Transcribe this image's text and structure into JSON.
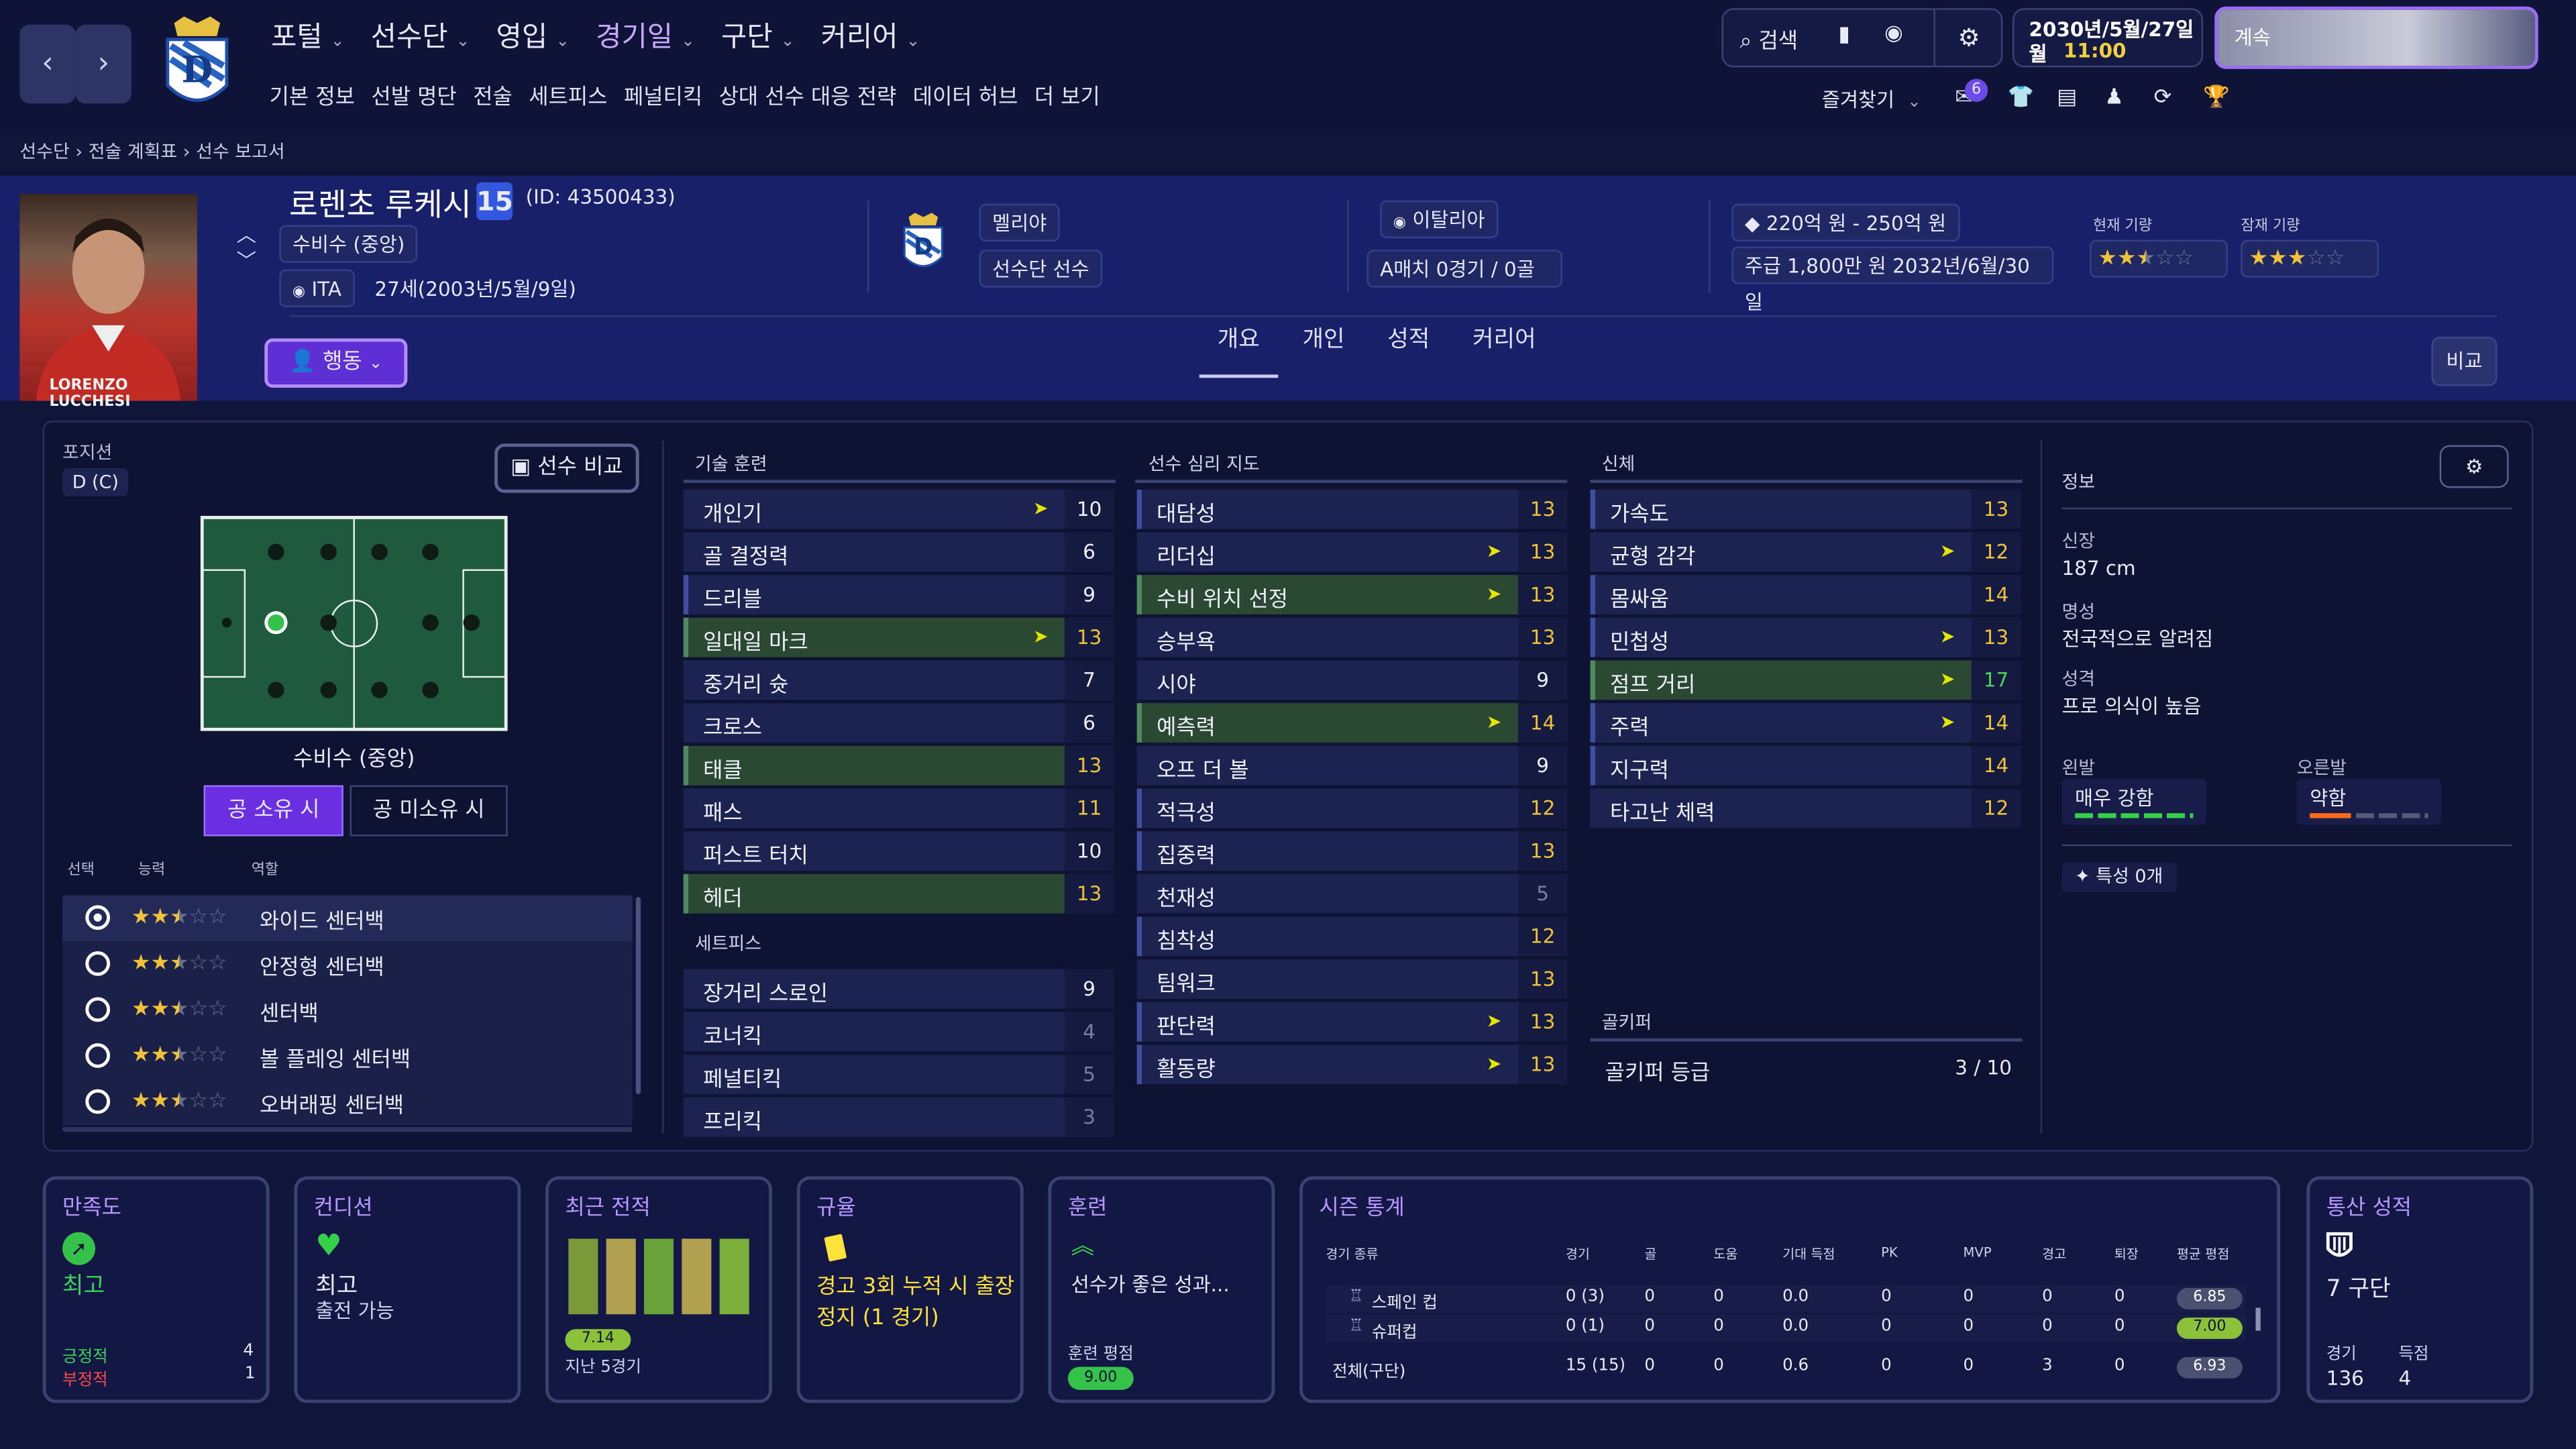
{
  "nav": {
    "menu": [
      "포털",
      "선수단",
      "영입",
      "경기일",
      "구단",
      "커리어"
    ],
    "active": "경기일",
    "submenu": [
      "기본 정보",
      "선발 명단",
      "전술",
      "세트피스",
      "페널티킥",
      "상대 선수 대응 전략",
      "데이터 허브",
      "더 보기"
    ],
    "search": "검색",
    "date_line1": "2030년/5월/27일",
    "date_line2": "월",
    "time": "11:00",
    "continue": "계속",
    "favorites": "즐겨찾기",
    "badge": "6"
  },
  "breadcrumb": [
    "선수단",
    "전술 계획표",
    "선수 보고서"
  ],
  "player": {
    "name": "로렌초 루케시",
    "number": "15",
    "id": "(ID: 43500433)",
    "position": "수비수 (중앙)",
    "nation": "ITA",
    "age": "27세(2003년/5월/9일)",
    "photo_caption": "LORENZO LUCCHESI",
    "club": "멜리야",
    "status": "선수단 선수",
    "nationality": "이탈리아",
    "caps": "A매치 0경기 / 0골",
    "value": "220억 원 - 250억 원",
    "wage": "주급 1,800만 원 2032년/6월/30일",
    "ca_label": "현재 기량",
    "pa_label": "잠재 기량",
    "ca_stars": 2.5,
    "pa_stars": 3,
    "action": "행동"
  },
  "tabs": [
    "개요",
    "개인",
    "성적",
    "커리어"
  ],
  "tabs_active": "개요",
  "compare": "비교",
  "left": {
    "pos_label": "포지션",
    "pos_value": "D (C)",
    "compare_btn": "선수 비교",
    "pitch_label": "수비수 (중앙)",
    "in_poss": "공 소유 시",
    "out_poss": "공 미소유 시",
    "col_select": "선택",
    "col_ability": "능력",
    "col_role": "역할",
    "roles": [
      {
        "name": "와이드 센터백",
        "stars": 2.5,
        "selected": true
      },
      {
        "name": "안정형 센터백",
        "stars": 2.5,
        "selected": false
      },
      {
        "name": "센터백",
        "stars": 2.5,
        "selected": false
      },
      {
        "name": "볼 플레잉 센터백",
        "stars": 2.5,
        "selected": false
      },
      {
        "name": "오버래핑 센터백",
        "stars": 2.5,
        "selected": false
      }
    ]
  },
  "technical": {
    "title": "기술 훈련",
    "attrs": [
      {
        "n": "개인기",
        "v": "10",
        "arrow": true
      },
      {
        "n": "골 결정력",
        "v": "6"
      },
      {
        "n": "드리블",
        "v": "9",
        "mark": "bl"
      },
      {
        "n": "일대일 마크",
        "v": "13",
        "mark": "hl",
        "arrow": true
      },
      {
        "n": "중거리 슛",
        "v": "7"
      },
      {
        "n": "크로스",
        "v": "6"
      },
      {
        "n": "태클",
        "v": "13",
        "mark": "hl"
      },
      {
        "n": "패스",
        "v": "11"
      },
      {
        "n": "퍼스트 터치",
        "v": "10"
      },
      {
        "n": "헤더",
        "v": "13",
        "mark": "hl"
      }
    ]
  },
  "setpieces": {
    "title": "세트피스",
    "attrs": [
      {
        "n": "장거리 스로인",
        "v": "9"
      },
      {
        "n": "코너킥",
        "v": "4"
      },
      {
        "n": "페널티킥",
        "v": "5"
      },
      {
        "n": "프리킥",
        "v": "3"
      }
    ]
  },
  "mental": {
    "title": "선수 심리 지도",
    "attrs": [
      {
        "n": "대담성",
        "v": "13",
        "mark": "bl"
      },
      {
        "n": "리더십",
        "v": "13",
        "arrow": true
      },
      {
        "n": "수비 위치 선정",
        "v": "13",
        "mark": "hl",
        "arrow": true
      },
      {
        "n": "승부욕",
        "v": "13"
      },
      {
        "n": "시야",
        "v": "9"
      },
      {
        "n": "예측력",
        "v": "14",
        "mark": "hl",
        "arrow": true
      },
      {
        "n": "오프 더 볼",
        "v": "9"
      },
      {
        "n": "적극성",
        "v": "12",
        "mark": "bl"
      },
      {
        "n": "집중력",
        "v": "13",
        "mark": "bl"
      },
      {
        "n": "천재성",
        "v": "5"
      },
      {
        "n": "침착성",
        "v": "12",
        "mark": "bl"
      },
      {
        "n": "팀워크",
        "v": "13"
      },
      {
        "n": "판단력",
        "v": "13",
        "mark": "bl",
        "arrow": true
      },
      {
        "n": "활동량",
        "v": "13",
        "mark": "bl",
        "arrow": true
      }
    ]
  },
  "physical": {
    "title": "신체",
    "attrs": [
      {
        "n": "가속도",
        "v": "13",
        "mark": "bl"
      },
      {
        "n": "균형 감각",
        "v": "12",
        "arrow": true
      },
      {
        "n": "몸싸움",
        "v": "14",
        "mark": "bl"
      },
      {
        "n": "민첩성",
        "v": "13",
        "mark": "bl",
        "arrow": true
      },
      {
        "n": "점프 거리",
        "v": "17",
        "mark": "hl",
        "arrow": true
      },
      {
        "n": "주력",
        "v": "14",
        "mark": "bl",
        "arrow": true
      },
      {
        "n": "지구력",
        "v": "14",
        "mark": "bl"
      },
      {
        "n": "타고난 체력",
        "v": "12"
      }
    ]
  },
  "gk": {
    "title": "골키퍼",
    "label": "골키퍼 등급",
    "value": "3 / 10"
  },
  "info": {
    "title": "정보",
    "height_l": "신장",
    "height": "187 cm",
    "rep_l": "명성",
    "rep": "전국적으로 알려짐",
    "pers_l": "성격",
    "pers": "프로 의식이 높음",
    "left_l": "왼발",
    "left": "매우 강함",
    "right_l": "오른발",
    "right": "약함",
    "traits": "특성 0개"
  },
  "cards": {
    "sat_t": "만족도",
    "sat": "최고",
    "pos_l": "긍정적",
    "pos_v": "4",
    "neg_l": "부정적",
    "neg_v": "1",
    "cond_t": "컨디션",
    "cond": "최고",
    "cond2": "출전 가능",
    "form_t": "최근 전적",
    "form_avg": "7.14",
    "form_l": "지난 5경기",
    "disc_t": "규율",
    "disc": "경고 3회 누적 시 출장 정지 (1 경기)",
    "train_t": "훈련",
    "train": "선수가 좋은 성과...",
    "train_l": "훈련 평점",
    "train_v": "9.00",
    "season_t": "시즌 통계",
    "cols": [
      "경기 종류",
      "경기",
      "골",
      "도움",
      "기대 득점",
      "PK",
      "MVP",
      "경고",
      "퇴장",
      "평균 평점"
    ],
    "rows": [
      [
        "스페인 컵",
        "0 (3)",
        "0",
        "0",
        "0.0",
        "0",
        "0",
        "0",
        "0",
        "6.85"
      ],
      [
        "슈퍼컵",
        "0 (1)",
        "0",
        "0",
        "0.0",
        "0",
        "0",
        "0",
        "0",
        "7.00"
      ],
      [
        "전체(구단)",
        "15 (15)",
        "0",
        "0",
        "0.6",
        "0",
        "0",
        "3",
        "0",
        "6.93"
      ]
    ],
    "career_t": "통산 성적",
    "career": "7 구단",
    "games_l": "경기",
    "games": "136",
    "goals_l": "득점",
    "goals": "4"
  }
}
